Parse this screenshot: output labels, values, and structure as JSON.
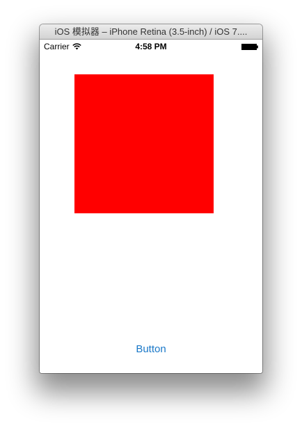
{
  "window": {
    "title": "iOS 模拟器 – iPhone Retina (3.5-inch) / iOS 7...."
  },
  "status_bar": {
    "carrier": "Carrier",
    "time": "4:58 PM",
    "wifi_icon": "wifi-icon",
    "battery_icon": "battery-icon"
  },
  "content": {
    "square_color": "#ff0000",
    "button_label": "Button",
    "button_color": "#1a78c8"
  }
}
